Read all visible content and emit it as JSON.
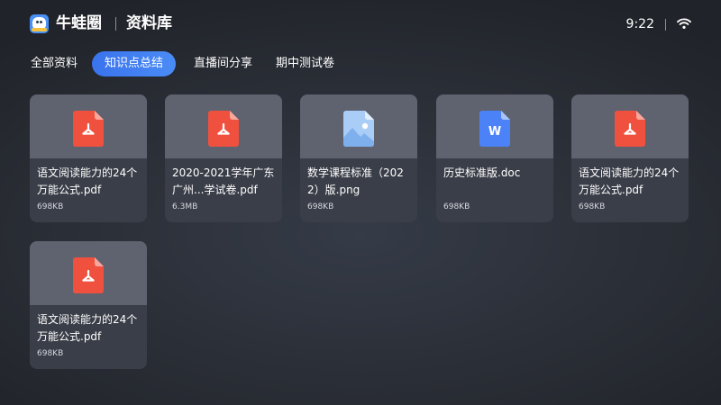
{
  "header": {
    "app_name": "牛蛙圈",
    "page_title": "资料库",
    "time": "9:22",
    "logo_icon": "frog-mascot-logo",
    "wifi_icon": "wifi-icon"
  },
  "tabs": [
    {
      "label": "全部资料",
      "active": false
    },
    {
      "label": "知识点总结",
      "active": true
    },
    {
      "label": "直播间分享",
      "active": false
    },
    {
      "label": "期中测试卷",
      "active": false
    }
  ],
  "colors": {
    "accent": "#3d7bf0",
    "pdf": "#f0513f",
    "word": "#4c82f7",
    "image": "#a9cdf6"
  },
  "files": [
    {
      "name": "语文阅读能力的24个万能公式.pdf",
      "size": "698KB",
      "type": "pdf",
      "icon": "pdf-file-icon"
    },
    {
      "name": "2020-2021学年广东广州...学试卷.pdf",
      "size": "6.3MB",
      "type": "pdf",
      "icon": "pdf-file-icon"
    },
    {
      "name": "数学课程标准（2022）版.png",
      "size": "698KB",
      "type": "image",
      "icon": "image-file-icon"
    },
    {
      "name": "历史标准版.doc",
      "size": "698KB",
      "type": "word",
      "icon": "word-file-icon",
      "icon_letter": "W"
    },
    {
      "name": "语文阅读能力的24个万能公式.pdf",
      "size": "698KB",
      "type": "pdf",
      "icon": "pdf-file-icon"
    },
    {
      "name": "语文阅读能力的24个万能公式.pdf",
      "size": "698KB",
      "type": "pdf",
      "icon": "pdf-file-icon"
    }
  ]
}
